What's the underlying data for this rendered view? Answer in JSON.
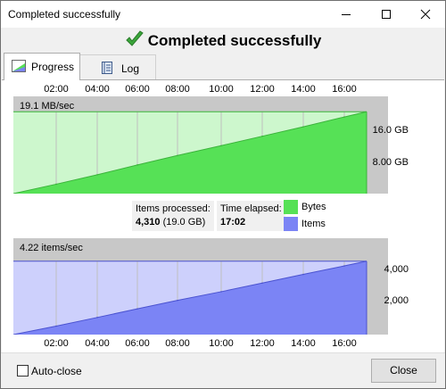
{
  "window": {
    "title": "Completed successfully"
  },
  "headline": {
    "text": "Completed successfully"
  },
  "tabs": [
    {
      "label": "Progress",
      "active": true,
      "icon": "progress-chart-icon"
    },
    {
      "label": "Log",
      "active": false,
      "icon": "log-book-icon"
    }
  ],
  "time_axis": [
    "02:00",
    "04:00",
    "06:00",
    "08:00",
    "10:00",
    "12:00",
    "14:00",
    "16:00"
  ],
  "bytes_chart": {
    "rate": "19.1 MB/sec",
    "y_labels": [
      "16.0 GB",
      "8.00 GB"
    ],
    "current_value_gb": 19.0
  },
  "stats": {
    "items_processed_label": "Items processed:",
    "items_processed_value": "4,310",
    "items_processed_size": "(19.0 GB)",
    "time_elapsed_label": "Time elapsed:",
    "time_elapsed_value": "17:02"
  },
  "legend": [
    {
      "label": "Bytes",
      "color": "#56e156"
    },
    {
      "label": "Items",
      "color": "#7b84f5"
    }
  ],
  "items_chart": {
    "rate": "4.22 items/sec",
    "y_labels": [
      "4,000",
      "2,000"
    ],
    "current_value": 4310
  },
  "footer": {
    "auto_close_label": "Auto-close",
    "auto_close_checked": false,
    "close_label": "Close"
  },
  "colors": {
    "bytes_fill": "#56e156",
    "bytes_light": "#cdf7cd",
    "bytes_line": "#3bb33b",
    "items_fill": "#7b84f5",
    "items_light": "#cdd0fc",
    "items_line": "#4a52d0",
    "check_green": "#3aa63a"
  },
  "chart_data": [
    {
      "type": "area",
      "x": [
        "02:00",
        "04:00",
        "06:00",
        "08:00",
        "10:00",
        "12:00",
        "14:00",
        "16:00"
      ],
      "series": [
        {
          "name": "Bytes",
          "values": [
            2.2,
            4.4,
            6.7,
            8.9,
            11.2,
            13.4,
            15.6,
            17.9
          ]
        }
      ],
      "ylabel": "",
      "ylim": [
        0,
        20
      ]
    },
    {
      "type": "area",
      "x": [
        "02:00",
        "04:00",
        "06:00",
        "08:00",
        "10:00",
        "12:00",
        "14:00",
        "16:00"
      ],
      "series": [
        {
          "name": "Items",
          "values": [
            500,
            1010,
            1520,
            2020,
            2530,
            3040,
            3550,
            4050
          ]
        }
      ],
      "ylabel": "",
      "ylim": [
        0,
        5000
      ]
    }
  ]
}
